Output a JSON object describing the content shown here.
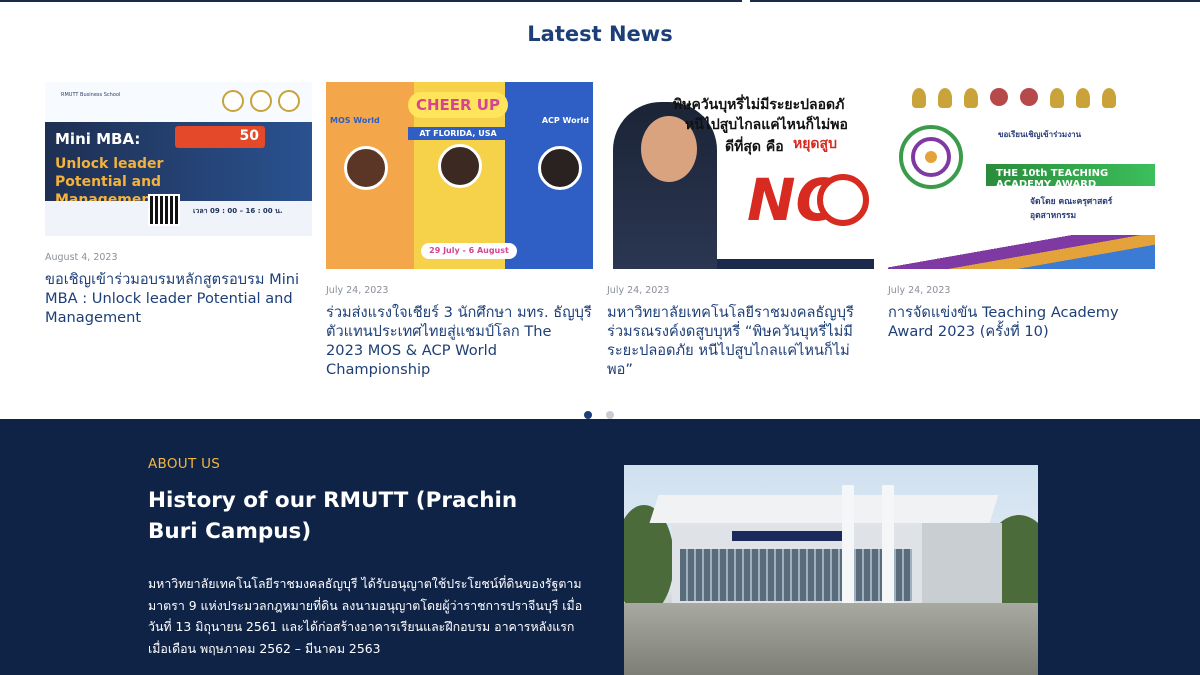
{
  "news": {
    "heading": "Latest News",
    "items": [
      {
        "date": "August 4, 2023",
        "title": "ขอเชิญเข้าร่วมอบรมหลักสูตรอบรม Mini MBA : Unlock leader Potential and Management",
        "thumb": {
          "school": "RMUTT Business School",
          "headline1": "Mini MBA:",
          "headline2": "Unlock leader Potential and Management",
          "capacity": "50",
          "schedule": "เวลา 09 : 00 – 16 : 00 น."
        }
      },
      {
        "date": "July 24, 2023",
        "title": "ร่วมส่งแรงใจเชียร์ 3 นักศึกษา มทร. ธัญบุรี ตัวแทนประเทศไทยสู่แชมป์โลก The 2023 MOS & ACP World Championship",
        "thumb": {
          "cheer": "CHEER UP",
          "location": "AT FLORIDA, USA",
          "mos": "MOS World",
          "acp": "ACP World",
          "dates": "29 July - 6 August"
        }
      },
      {
        "date": "July 24, 2023",
        "title": "มหาวิทยาลัยเทคโนโลยีราชมงคลธัญบุรี ร่วมรณรงค์งดสูบบุหรี่ “พิษควันบุหรี่ไม่มีระยะปลอดภัย หนีไปสูบไกลแค่ไหนก็ไม่พอ”",
        "thumb": {
          "line1": "พิษควันบุหรี่ไม่มีระยะปลอดภั",
          "line2": "หนีไปสูบไกลแค่ไหนก็ไม่พอ",
          "line3": "ดีที่สุด คือ",
          "stop": "หยุดสูบ",
          "no": "NO"
        }
      },
      {
        "date": "July 24, 2023",
        "title": "การจัดแข่งขัน Teaching Academy Award 2023 (ครั้งที่ 10)",
        "thumb": {
          "invite": "ขอเรียนเชิญเข้าร่วมงาน",
          "award": "THE 10th TEACHING ACADEMY AWARD",
          "org": "จัดโดย คณะครุศาสตร์อุตสาหกรรม"
        }
      }
    ]
  },
  "pagination": {
    "active_index": 0,
    "count": 2
  },
  "about": {
    "kicker": "ABOUT US",
    "title": "History of our RMUTT (Prachin Buri Campus)",
    "body": "มหาวิทยาลัยเทคโนโลยีราชมงคลธัญบุรี ได้รับอนุญาตใช้ประโยชน์ที่ดินของรัฐตามมาตรา 9 แห่งประมวลกฎหมายที่ดิน ลงนามอนุญาตโดยผู้ว่าราชการปราจีนบุรี เมื่อวันที่ 13 มิถุนายน 2561 และได้ก่อสร้างอาคารเรียนและฝึกอบรม อาคารหลังแรก เมื่อเดือน พฤษภาคม 2562 – มีนาคม 2563"
  },
  "colors": {
    "navy": "#0f2347",
    "title_blue": "#1d3f78",
    "accent_gold": "#f2b640",
    "date_gray": "#8a8f99"
  }
}
